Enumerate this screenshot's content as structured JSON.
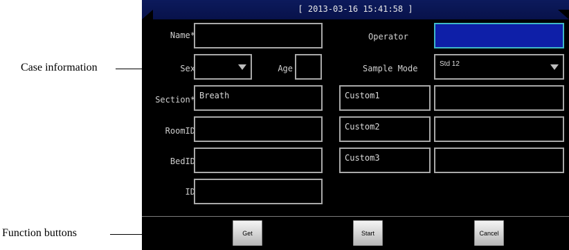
{
  "callouts": {
    "case_information": "Case information",
    "function_buttons": "Function buttons"
  },
  "header": {
    "timestamp": "[ 2013-03-16 15:41:58 ]"
  },
  "form": {
    "name_label": "Name*",
    "name_value": "",
    "operator_label": "Operator",
    "operator_value": "",
    "sex_label": "Sex",
    "sex_value": "",
    "age_label": "Age",
    "age_value": "",
    "sample_mode_label": "Sample Mode",
    "sample_mode_value": "Std 12",
    "section_label": "Section*",
    "section_value": "Breath",
    "room_id_label": "RoomID",
    "room_id_value": "",
    "bed_id_label": "BedID",
    "bed_id_value": "",
    "id_label": "ID",
    "id_value": "",
    "custom1_label": "Custom1",
    "custom1_value": "",
    "custom2_label": "Custom2",
    "custom2_value": "",
    "custom3_label": "Custom3",
    "custom3_value": ""
  },
  "buttons": {
    "get": "Get",
    "start": "Start",
    "cancel": "Cancel"
  }
}
